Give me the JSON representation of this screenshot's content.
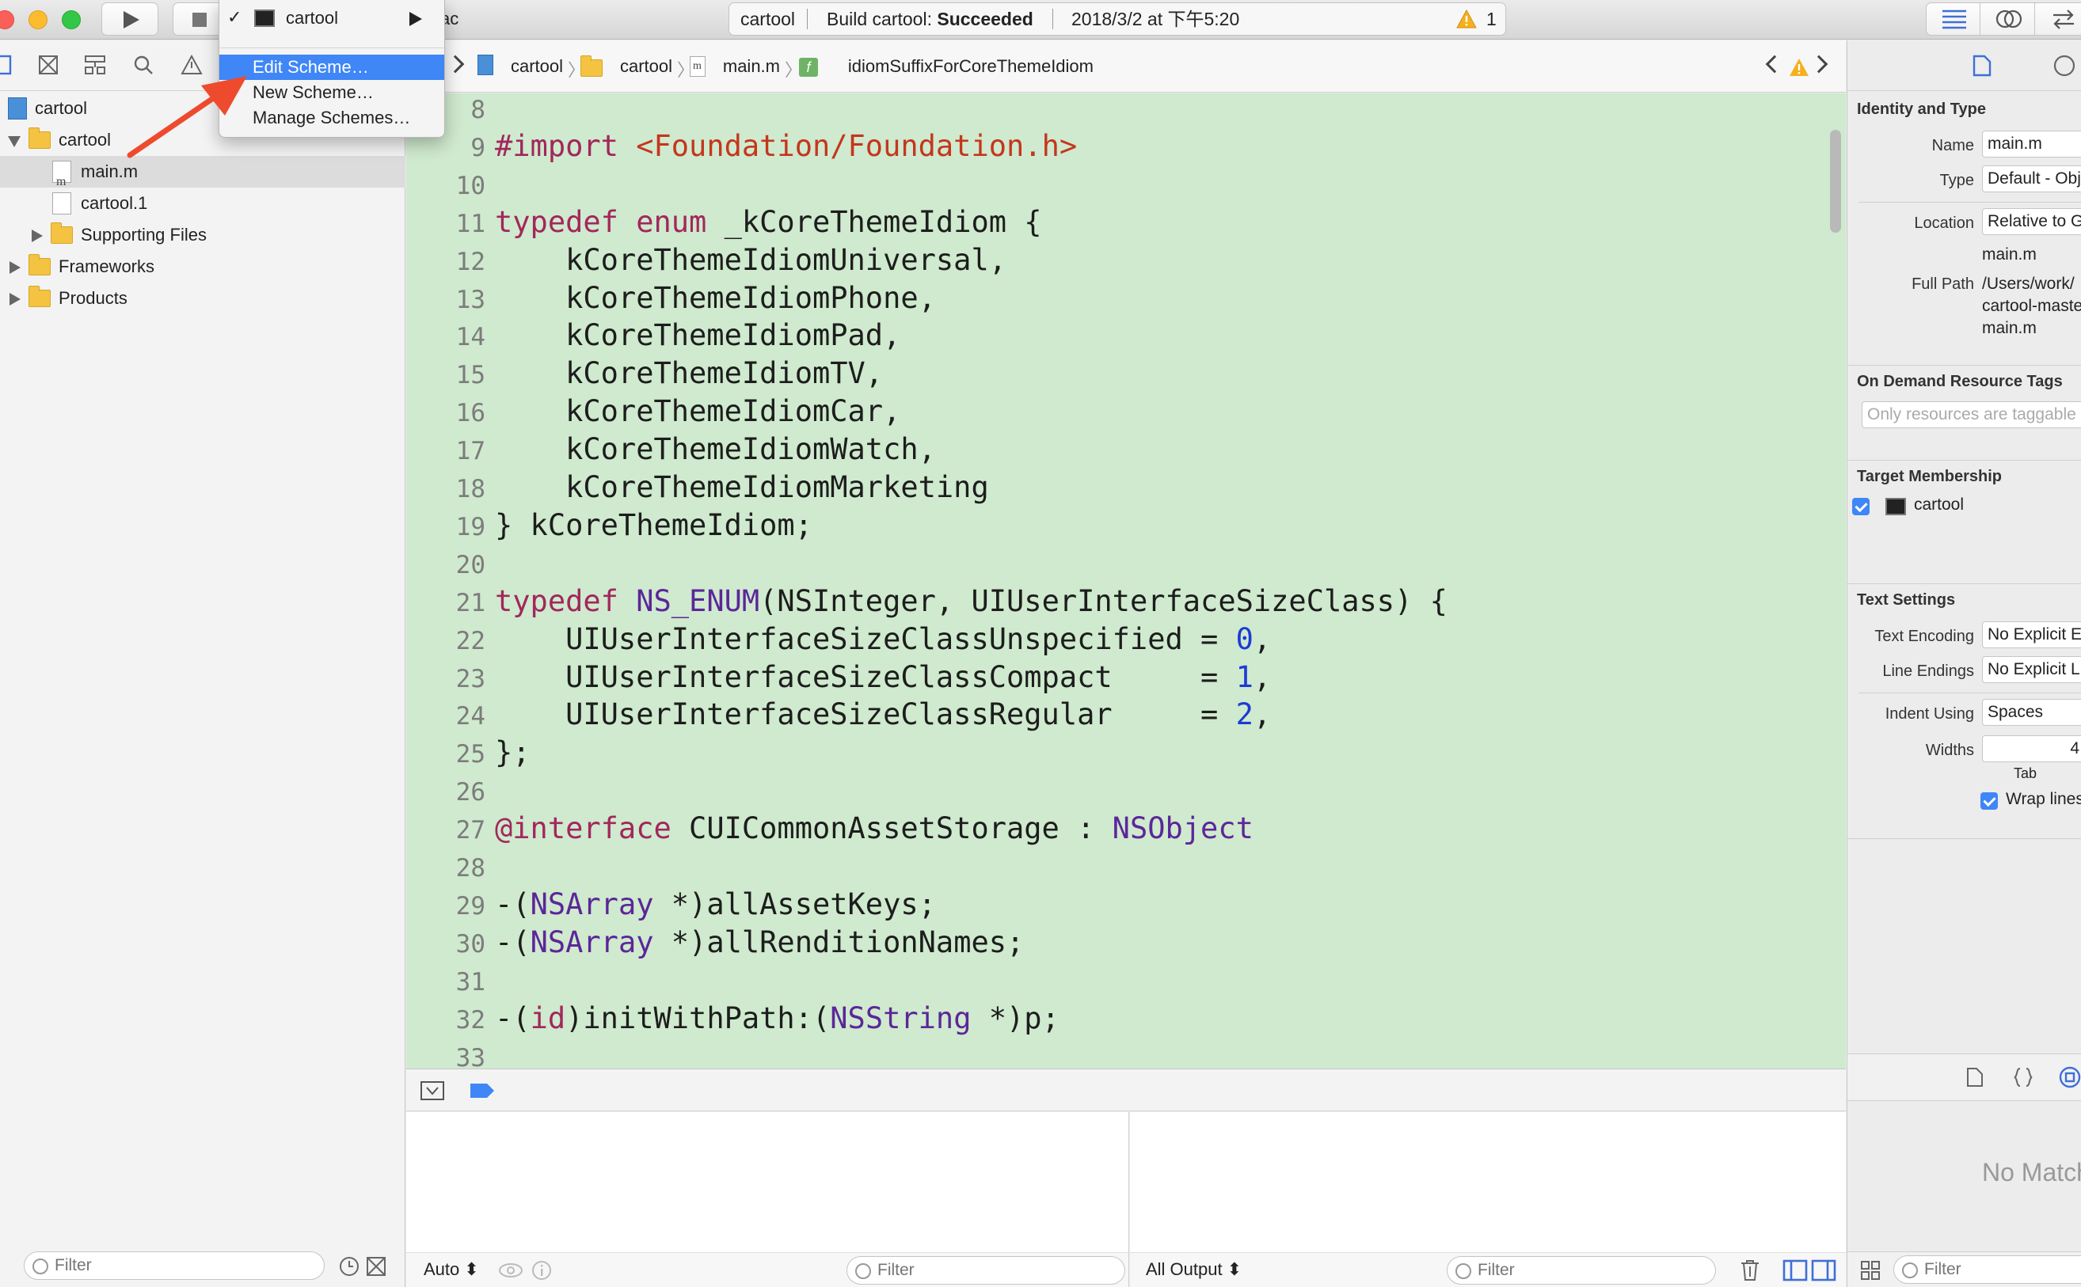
{
  "toolbar": {
    "scheme_tail": "ac",
    "activity": {
      "project": "cartool",
      "status_prefix": "Build cartool: ",
      "status_strong": "Succeeded",
      "timestamp": "2018/3/2 at 下午5:20",
      "warning_count": "1"
    }
  },
  "scheme_menu": {
    "current_scheme": "cartool",
    "items": [
      "Edit Scheme…",
      "New Scheme…",
      "Manage Schemes…"
    ]
  },
  "navigator": {
    "tree": [
      {
        "label": "cartool",
        "kind": "project"
      },
      {
        "label": "cartool",
        "kind": "group"
      },
      {
        "label": "main.m",
        "kind": "file"
      },
      {
        "label": "cartool.1",
        "kind": "file"
      },
      {
        "label": "Supporting Files",
        "kind": "group"
      },
      {
        "label": "Frameworks",
        "kind": "group"
      },
      {
        "label": "Products",
        "kind": "group"
      }
    ],
    "filter_placeholder": "Filter"
  },
  "jumpbar": {
    "crumbs": [
      "cartool",
      "cartool",
      "main.m",
      "idiomSuffixForCoreThemeIdiom"
    ],
    "crumb_icon_letters": [
      "m",
      "f"
    ]
  },
  "editor": {
    "lines": [
      {
        "n": "8",
        "parts": []
      },
      {
        "n": "9",
        "parts": [
          [
            "kw",
            "#import "
          ],
          [
            "str",
            "<Foundation/Foundation.h>"
          ]
        ]
      },
      {
        "n": "10",
        "parts": []
      },
      {
        "n": "11",
        "parts": [
          [
            "kw",
            "typedef"
          ],
          [
            "",
            " "
          ],
          [
            "kw",
            "enum"
          ],
          [
            "",
            " _kCoreThemeIdiom {"
          ]
        ]
      },
      {
        "n": "12",
        "parts": [
          [
            "",
            "    kCoreThemeIdiomUniversal,"
          ]
        ]
      },
      {
        "n": "13",
        "parts": [
          [
            "",
            "    kCoreThemeIdiomPhone,"
          ]
        ]
      },
      {
        "n": "14",
        "parts": [
          [
            "",
            "    kCoreThemeIdiomPad,"
          ]
        ]
      },
      {
        "n": "15",
        "parts": [
          [
            "",
            "    kCoreThemeIdiomTV,"
          ]
        ]
      },
      {
        "n": "16",
        "parts": [
          [
            "",
            "    kCoreThemeIdiomCar,"
          ]
        ]
      },
      {
        "n": "17",
        "parts": [
          [
            "",
            "    kCoreThemeIdiomWatch,"
          ]
        ]
      },
      {
        "n": "18",
        "parts": [
          [
            "",
            "    kCoreThemeIdiomMarketing"
          ]
        ]
      },
      {
        "n": "19",
        "parts": [
          [
            "",
            "} kCoreThemeIdiom;"
          ]
        ]
      },
      {
        "n": "20",
        "parts": []
      },
      {
        "n": "21",
        "parts": [
          [
            "kw",
            "typedef"
          ],
          [
            "",
            " "
          ],
          [
            "ty",
            "NS_ENUM"
          ],
          [
            "",
            "(NSInteger, UIUserInterfaceSizeClass) {"
          ]
        ]
      },
      {
        "n": "22",
        "parts": [
          [
            "",
            "    UIUserInterfaceSizeClassUnspecified = "
          ],
          [
            "num",
            "0"
          ],
          [
            "",
            ","
          ]
        ]
      },
      {
        "n": "23",
        "parts": [
          [
            "",
            "    UIUserInterfaceSizeClassCompact     = "
          ],
          [
            "num",
            "1"
          ],
          [
            "",
            ","
          ]
        ]
      },
      {
        "n": "24",
        "parts": [
          [
            "",
            "    UIUserInterfaceSizeClassRegular     = "
          ],
          [
            "num",
            "2"
          ],
          [
            "",
            ","
          ]
        ]
      },
      {
        "n": "25",
        "parts": [
          [
            "",
            "};"
          ]
        ]
      },
      {
        "n": "26",
        "parts": []
      },
      {
        "n": "27",
        "parts": [
          [
            "kw",
            "@interface"
          ],
          [
            "",
            " CUICommonAssetStorage : "
          ],
          [
            "ty",
            "NSObject"
          ]
        ]
      },
      {
        "n": "28",
        "parts": []
      },
      {
        "n": "29",
        "parts": [
          [
            "",
            "-("
          ],
          [
            "ty",
            "NSArray"
          ],
          [
            "",
            " *)allAssetKeys;"
          ]
        ]
      },
      {
        "n": "30",
        "parts": [
          [
            "",
            "-("
          ],
          [
            "ty",
            "NSArray"
          ],
          [
            "",
            " *)allRenditionNames;"
          ]
        ]
      },
      {
        "n": "31",
        "parts": []
      },
      {
        "n": "32",
        "parts": [
          [
            "",
            "-("
          ],
          [
            "kw",
            "id"
          ],
          [
            "",
            ")initWithPath:("
          ],
          [
            "ty",
            "NSString"
          ],
          [
            "",
            " *)p;"
          ]
        ]
      },
      {
        "n": "33",
        "parts": []
      }
    ]
  },
  "debug": {
    "variables_scope": "Auto",
    "console_scope": "All Output",
    "filter_placeholder": "Filter"
  },
  "inspector": {
    "identity_header": "Identity and Type",
    "name_label": "Name",
    "name_value": "main.m",
    "type_label": "Type",
    "type_value": "Default - Objective-C Source",
    "location_label": "Location",
    "location_value": "Relative to Group",
    "location_path": "main.m",
    "fullpath_label": "Full Path",
    "fullpath_lines": [
      "/Users/work/",
      "cartool-master/",
      "main.m"
    ],
    "odr_header": "On Demand Resource Tags",
    "odr_placeholder": "Only resources are taggable",
    "target_header": "Target Membership",
    "target_name": "cartool",
    "text_header": "Text Settings",
    "encoding_label": "Text Encoding",
    "encoding_value": "No Explicit Encoding",
    "endings_label": "Line Endings",
    "endings_value": "No Explicit Line Endings",
    "indent_label": "Indent Using",
    "indent_value": "Spaces",
    "widths_label": "Widths",
    "widths_value": "4",
    "tab_label": "Tab",
    "wrap_label": "Wrap lines",
    "no_matches": "No Matches",
    "filter_placeholder": "Filter"
  },
  "colors": {
    "editor_background": "#cfeace",
    "keyword": "#a2275c",
    "string": "#c4361d",
    "type": "#5c2699",
    "number": "#1c3bd5",
    "menu_highlight": "#3f86f7",
    "annotation_arrow": "#ee4a2d"
  }
}
